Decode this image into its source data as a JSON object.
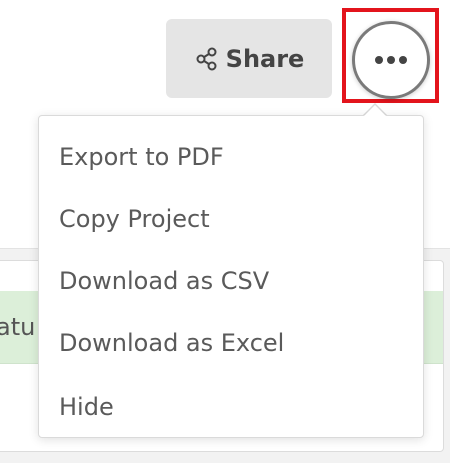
{
  "toolbar": {
    "share_label": "Share",
    "share_icon": "share-icon",
    "more_icon": "more-horizontal-icon",
    "highlight_color": "#e3141c"
  },
  "background": {
    "status_text": "atu"
  },
  "menu": {
    "items": [
      {
        "label": "Export to PDF"
      },
      {
        "label": "Copy Project"
      },
      {
        "label": "Download as CSV"
      },
      {
        "label": "Download as Excel"
      },
      {
        "label": "Hide"
      }
    ]
  }
}
